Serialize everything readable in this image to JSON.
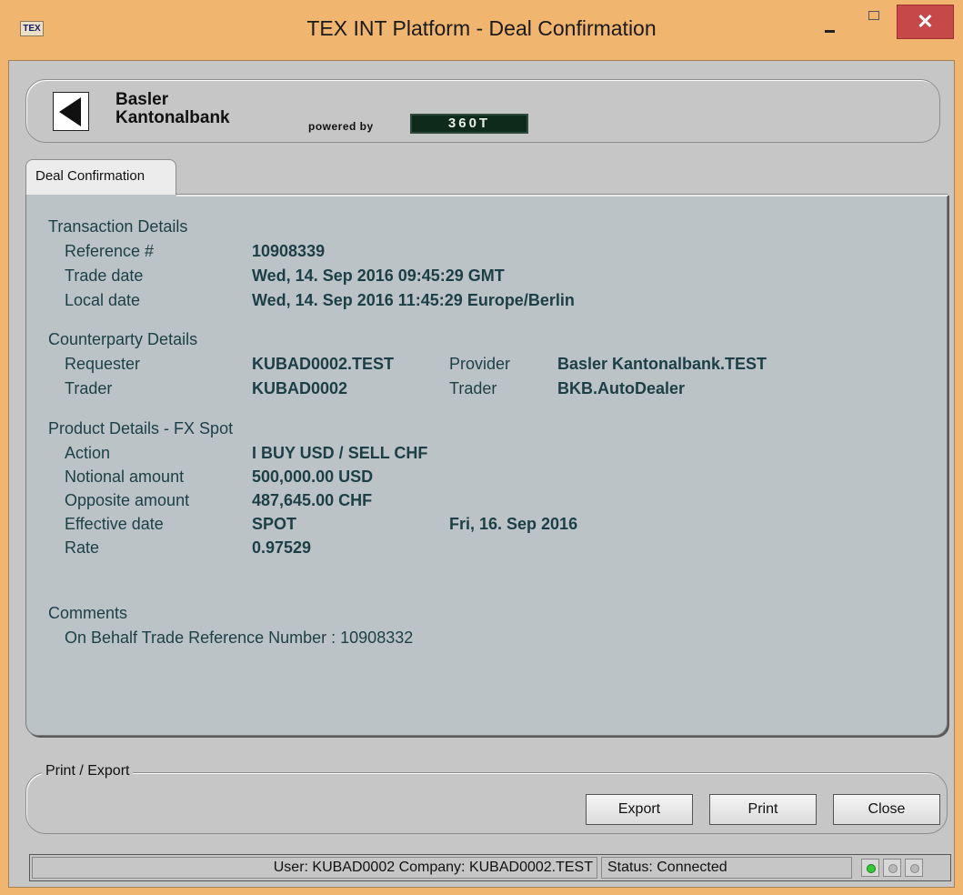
{
  "window": {
    "app_icon": "TEX",
    "title": "TEX INT Platform - Deal Confirmation",
    "close_glyph": "✕"
  },
  "header": {
    "bank_name_line1": "Basler",
    "bank_name_line2": "Kantonalbank",
    "powered_by": "powered by",
    "provider_logo": "360T"
  },
  "tabs": [
    {
      "label": "Deal Confirmation",
      "active": true
    }
  ],
  "transaction": {
    "title": "Transaction Details",
    "reference_label": "Reference #",
    "reference_value": "10908339",
    "trade_date_label": "Trade date",
    "trade_date_value": "Wed, 14. Sep 2016 09:45:29 GMT",
    "local_date_label": "Local date",
    "local_date_value": "Wed, 14. Sep 2016 11:45:29 Europe/Berlin"
  },
  "counterparty": {
    "title": "Counterparty Details",
    "requester_label": "Requester",
    "requester_value": "KUBAD0002.TEST",
    "trader_label": "Trader",
    "trader_value": "KUBAD0002",
    "provider_label": "Provider",
    "provider_value": "Basler Kantonalbank.TEST",
    "provider_trader_label": "Trader",
    "provider_trader_value": "BKB.AutoDealer"
  },
  "product": {
    "title": "Product Details - FX Spot",
    "action_label": "Action",
    "action_value": "I BUY USD / SELL CHF",
    "notional_label": "Notional amount",
    "notional_value": "500,000.00 USD",
    "opposite_label": "Opposite amount",
    "opposite_value": "487,645.00 CHF",
    "effective_label": "Effective date",
    "effective_value": "SPOT",
    "effective_date": "Fri, 16. Sep 2016",
    "rate_label": "Rate",
    "rate_value": "0.97529"
  },
  "comments": {
    "title": "Comments",
    "text": "On Behalf Trade Reference Number : 10908332"
  },
  "print_export": {
    "legend": "Print / Export",
    "export_label": "Export",
    "print_label": "Print",
    "close_label": "Close"
  },
  "status_bar": {
    "user_text": "User: KUBAD0002 Company: KUBAD0002.TEST",
    "status_text": "Status:  Connected",
    "leds": [
      "on",
      "off",
      "off"
    ]
  },
  "colors": {
    "frame": "#f0b56e",
    "panel": "#c6c6c6",
    "tab_body": "#bcc3c6",
    "text_teal": "#1c3f46",
    "close_button": "#c74848",
    "led_on": "#33cc33"
  }
}
